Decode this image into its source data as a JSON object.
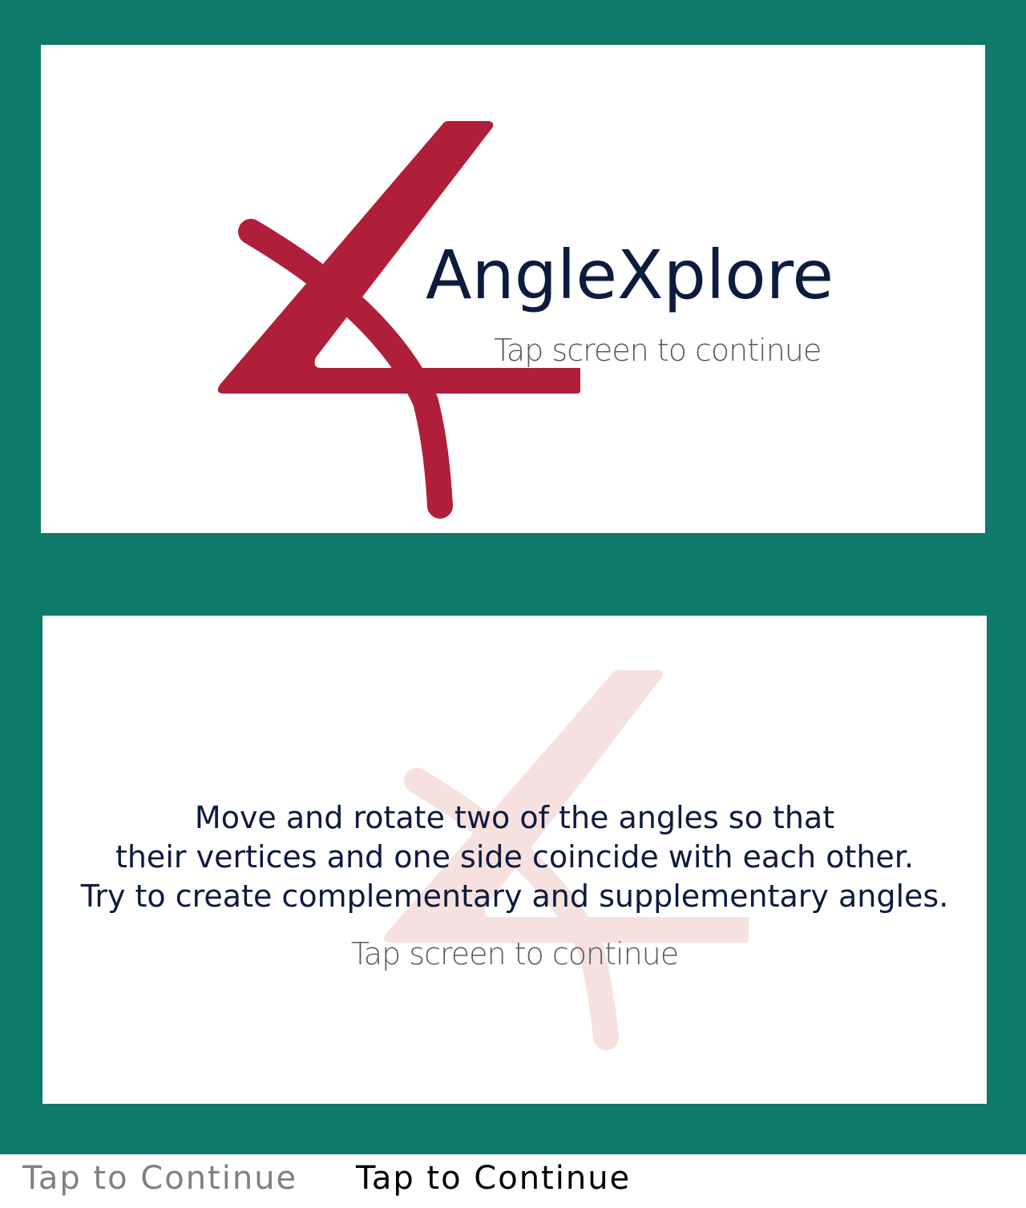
{
  "app": {
    "title": "AngleXplore"
  },
  "splash_panel": {
    "tap_hint": "Tap screen to continue"
  },
  "instructions_panel": {
    "lines": [
      "Move and rotate two of the angles so that",
      "their vertices and one side coincide with each other.",
      "Try to create complementary and supplementary angles."
    ],
    "tap_hint": "Tap screen to continue"
  },
  "footer": {
    "label_inactive": "Tap to Continue",
    "label_active": "Tap to Continue"
  },
  "colors": {
    "frame": "#0d7a6a",
    "panel": "#ffffff",
    "logo": "#b01f3a",
    "logo_faded": "#f6e1df",
    "title_text": "#0d1b3e",
    "hint_text": "#5a5a5a"
  },
  "icons": {
    "logo": "angle-protractor-icon"
  }
}
